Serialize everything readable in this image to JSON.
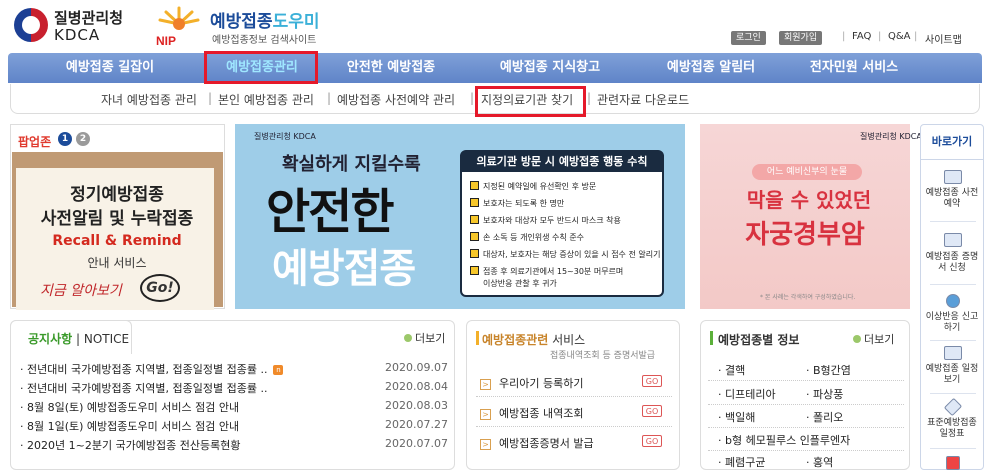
{
  "header": {
    "kdca_name": "질병관리청",
    "kdca_en": "KDCA",
    "nip_badge": "NIP",
    "site_title_a": "예방접종",
    "site_title_b": "도우미",
    "site_sub": "예방접종정보 검색사이트",
    "login": "로그인",
    "join": "회원가입",
    "faq": "FAQ",
    "qna": "Q&A",
    "sitemap": "사이트맵",
    "sep": "|"
  },
  "gnb": [
    "예방접종 길잡이",
    "예방접종관리",
    "안전한 예방접종",
    "예방접종 지식창고",
    "예방접종 알림터",
    "전자민원 서비스"
  ],
  "lnb": [
    "자녀 예방접종 관리",
    "본인 예방접종 관리",
    "예방접종 사전예약 관리",
    "지정의료기관 찾기",
    "관련자료 다운로드"
  ],
  "popup": {
    "title": "팝업존",
    "pages": [
      "1",
      "2"
    ],
    "line1": "정기예방접종",
    "line2": "사전알림 및 누락접종",
    "line3": "Recall & Remind",
    "line4": "안내 서비스",
    "line5": "지금 알아보기",
    "go": "Go!"
  },
  "main_banner": {
    "org": "질병관리청 KDCA",
    "line1": "확실하게 지킬수록",
    "line2": "안전한",
    "line3": "예방접종",
    "box_title": "의료기관 방문 시 예방접종 행동 수칙",
    "rules": [
      "지정된 예약일에 유선확인 후 방문",
      "보호자는 되도록 한 명만",
      "보호자와 대상자 모두 반드시 마스크 착용",
      "손 소독 등 개인위생 수칙 준수",
      "대상자, 보호자는 해당 증상이 있을 시 접수 전 알리기",
      "접종 후 의료기관에서 15~30분 머무르며",
      "이상반응 관찰 후 귀가"
    ]
  },
  "right_banner": {
    "org": "질병관리청 KDCA",
    "pill": "어느 예비신부의 눈물",
    "line1": "막을 수 있었던",
    "line2": "자궁경부암",
    "foot": "* 본 사례는 각색하여 구성하였습니다."
  },
  "quick": {
    "title": "바로가기",
    "items": [
      "예방접종 사전예약",
      "예방접종 증명서 신청",
      "이상반응 신고하기",
      "예방접종 일정보기",
      "표준예방접종 일정표"
    ]
  },
  "notice": {
    "tab_ko": "공지사항",
    "tab_sep": " | ",
    "tab_en": "NOTICE",
    "more": "더보기",
    "rows": [
      {
        "title": "· 전년대비 국가예방접종 지역별, 접종일정별 접종률 ..",
        "date": "2020.09.07",
        "new": "n"
      },
      {
        "title": "· 전년대비 국가예방접종 지역별, 접종일정별 접종률 ..",
        "date": "2020.08.04"
      },
      {
        "title": "· 8월 8일(토) 예방접종도우미 서비스 점검 안내",
        "date": "2020.08.03"
      },
      {
        "title": "· 8월 1일(토) 예방접종도우미 서비스 점검 안내",
        "date": "2020.07.27"
      },
      {
        "title": "· 2020년 1~2분기 국가예방접종 전산등록현황",
        "date": "2020.07.07"
      }
    ]
  },
  "vaccination_service": {
    "title_a": "예방접종관련",
    "title_b": " 서비스",
    "sub": "접종내역조회 등 증명서발급",
    "items": [
      "우리아기 등록하기",
      "예방접종 내역조회",
      "예방접종증명서 발급"
    ],
    "go": "GO",
    "arrow": ">"
  },
  "disease_info": {
    "title": "예방접종별 정보",
    "more": "더보기",
    "items": [
      "· 결핵",
      "· B형간염",
      "· 디프테리아",
      "· 파상풍",
      "· 백일해",
      "· 폴리오",
      "· b형 헤모필루스 인플루엔자",
      "· 폐렴구균",
      "· 홍역"
    ]
  },
  "colors": {
    "brand": "#1c4c9a",
    "gnb": "#6a8ece",
    "highlight": "#e5192a",
    "notice_green": "#3a9a2a",
    "accent_orange": "#f3b02a"
  }
}
